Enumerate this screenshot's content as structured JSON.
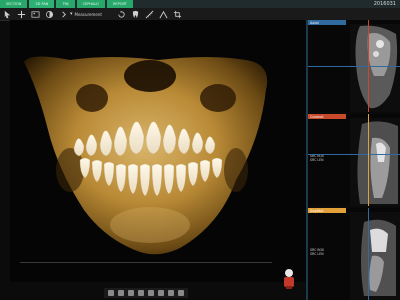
{
  "window": {
    "date": "2016031"
  },
  "tabs": [
    {
      "label": "SECTION"
    },
    {
      "label": "3D PAN"
    },
    {
      "label": "TMJ"
    },
    {
      "label": "CEPHALO"
    },
    {
      "label": "REPORT"
    }
  ],
  "toolbar": {
    "measurement_label": "Measurement",
    "icons": [
      "select-icon",
      "pan-icon",
      "image-icon",
      "window-level-icon",
      "tooth-icon",
      "measure-icon",
      "angle-icon",
      "crop-icon"
    ]
  },
  "viewer": {
    "type": "3D volume render",
    "subject": "mandible and maxilla with dentition"
  },
  "slices": [
    {
      "label": "Axial",
      "accent": "#2f6aa0",
      "info": [
        "",
        ""
      ]
    },
    {
      "label": "Coronal",
      "accent": "#c94a2b",
      "info": [
        "SRC BOX",
        "SRC LEN"
      ]
    },
    {
      "label": "Sagittal",
      "accent": "#e1a03a",
      "info": [
        "SRC BOX",
        "SRC LEN"
      ]
    }
  ],
  "colors": {
    "tab_active": "#27a86a",
    "panel_border": "#1b3b4d",
    "accent_blue": "#2f6aa0",
    "accent_red": "#c94a2b",
    "accent_orange": "#e1a03a"
  }
}
